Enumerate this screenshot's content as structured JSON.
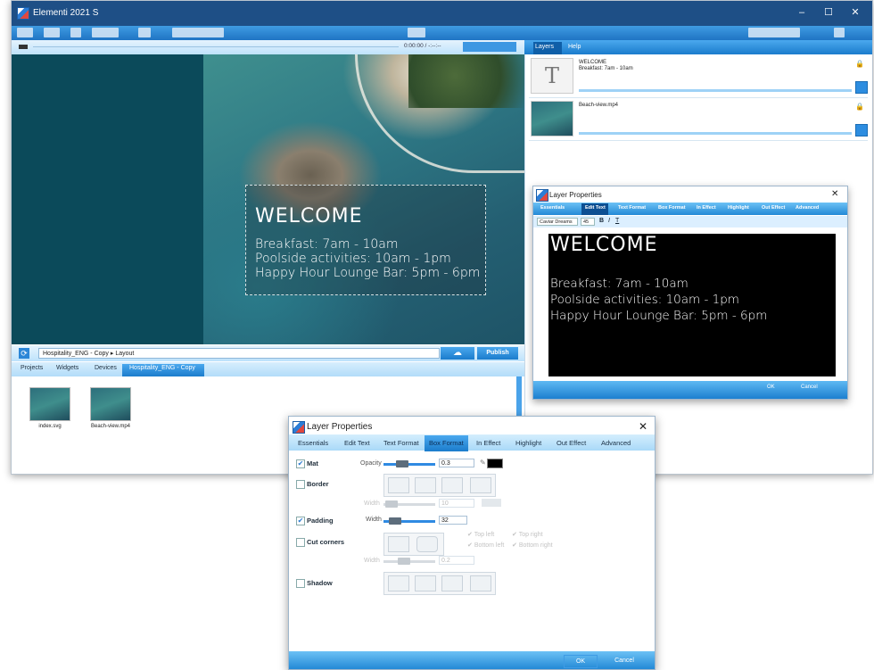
{
  "app": {
    "title": "Elementi 2021 S",
    "accent": "#1b7ccc"
  },
  "timebar": {
    "time": "0:00:00 / -:--:--"
  },
  "preview": {
    "heading": "WELCOME",
    "lines": [
      "Breakfast: 7am - 10am",
      "Poolside activities: 10am - 1pm",
      "Happy Hour Lounge Bar: 5pm - 6pm"
    ]
  },
  "pathbar": {
    "path": "Hospitality_ENG - Copy  ▸  Layout",
    "publish": "Publish"
  },
  "project_tabs": [
    "Projects",
    "Widgets",
    "Devices",
    "Hospitality_ENG - Copy"
  ],
  "files": [
    {
      "name": "index.svg"
    },
    {
      "name": "Beach-view.mp4"
    }
  ],
  "right_tabs": [
    "Layers",
    "Help"
  ],
  "layers": [
    {
      "title": "WELCOME",
      "subtitle": "Breakfast: 7am - 10am"
    },
    {
      "title": "Beach-view.mp4",
      "subtitle": ""
    }
  ],
  "small_dialog": {
    "title": "Layer Properties",
    "tabs": [
      "Essentials",
      "Edit Text",
      "Text Format",
      "Box Format",
      "In Effect",
      "Highlight",
      "Out Effect",
      "Advanced"
    ],
    "font": "Caviar Dreams",
    "font_size": "45",
    "heading": "WELCOME",
    "lines": [
      "Breakfast: 7am - 10am",
      "Poolside activities: 10am - 1pm",
      "Happy Hour Lounge Bar: 5pm - 6pm"
    ],
    "ok": "OK",
    "cancel": "Cancel"
  },
  "big_dialog": {
    "title": "Layer Properties",
    "tabs": [
      "Essentials",
      "Edit Text",
      "Text Format",
      "Box Format",
      "In Effect",
      "Highlight",
      "Out Effect",
      "Advanced"
    ],
    "active_tab": "Box Format",
    "mat": {
      "label": "Mat",
      "checked": true,
      "opacity_label": "Opacity",
      "opacity": "0.3",
      "color": "#000000"
    },
    "border": {
      "label": "Border",
      "checked": false,
      "width_label": "Width",
      "width": "10"
    },
    "padding": {
      "label": "Padding",
      "checked": true,
      "width_label": "Width",
      "width": "32"
    },
    "cut_corners": {
      "label": "Cut corners",
      "checked": false,
      "width_label": "Width",
      "width": "0.2",
      "corners": [
        "Top left",
        "Top right",
        "Bottom left",
        "Bottom right"
      ]
    },
    "shadow": {
      "label": "Shadow",
      "checked": false
    },
    "ok": "OK",
    "cancel": "Cancel"
  }
}
